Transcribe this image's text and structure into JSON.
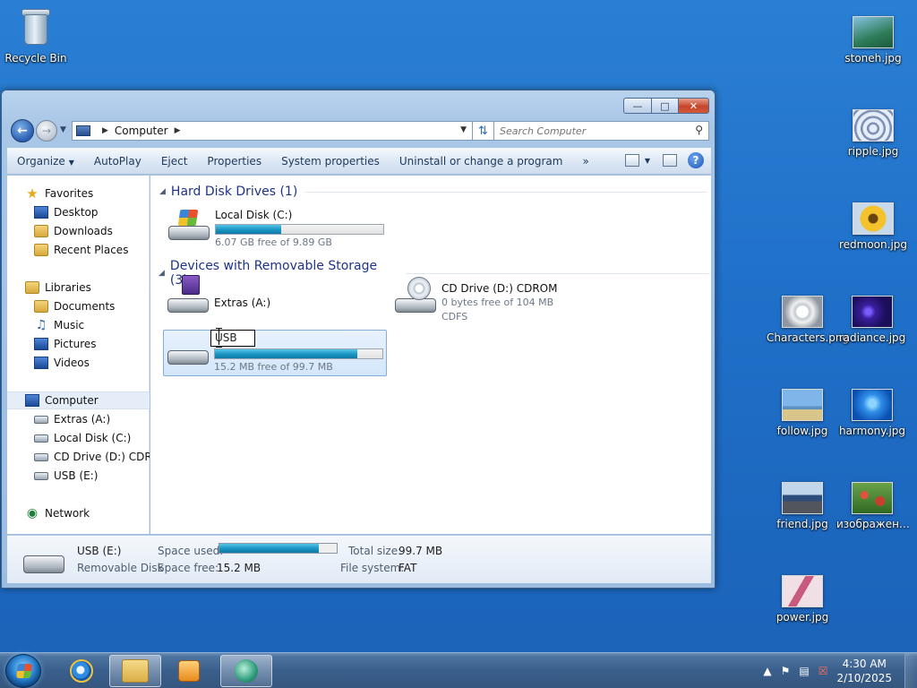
{
  "desktop": {
    "recycle_bin": "Recycle Bin",
    "files": [
      {
        "name": "stoneh.jpg",
        "colors": [
          "#2e7d5a",
          "#86c2e0"
        ]
      },
      {
        "name": "ripple.jpg",
        "colors": [
          "#d8e6f4",
          "#5a6f9a"
        ]
      },
      {
        "name": "redmoon.jpg",
        "colors": [
          "#f4c22c",
          "#e8a313"
        ]
      },
      {
        "name": "Characters.png",
        "colors": [
          "#e9e9e9",
          "#9aa3ad"
        ]
      },
      {
        "name": "radiance.jpg",
        "colors": [
          "#3a1d9a",
          "#1b0f5a"
        ]
      },
      {
        "name": "follow.jpg",
        "colors": [
          "#7fb6ea",
          "#d9c48a"
        ]
      },
      {
        "name": "harmony.jpg",
        "colors": [
          "#2f8ee8",
          "#0b4fb0"
        ]
      },
      {
        "name": "friend.jpg",
        "colors": [
          "#2d4e7a",
          "#c2d6ea"
        ]
      },
      {
        "name": "изображен…",
        "colors": [
          "#c7402e",
          "#3b7a2a"
        ]
      },
      {
        "name": "power.jpg",
        "colors": [
          "#f1dfe6",
          "#c9597d"
        ]
      }
    ]
  },
  "window": {
    "address": {
      "crumb": "Computer"
    },
    "search_placeholder": "Search Computer",
    "toolbar": {
      "organize": "Organize",
      "autoplay": "AutoPlay",
      "eject": "Eject",
      "properties": "Properties",
      "system_properties": "System properties",
      "uninstall": "Uninstall or change a program",
      "more": "»"
    },
    "nav": {
      "favorites": "Favorites",
      "desktop": "Desktop",
      "downloads": "Downloads",
      "recent": "Recent Places",
      "libraries": "Libraries",
      "documents": "Documents",
      "music": "Music",
      "pictures": "Pictures",
      "videos": "Videos",
      "computer": "Computer",
      "extras": "Extras (A:)",
      "local_disk": "Local Disk (C:)",
      "cd_drive": "CD Drive (D:) CDROM",
      "usb": "USB (E:)",
      "network": "Network"
    },
    "groups": {
      "hdd": "Hard Disk Drives (1)",
      "removable": "Devices with Removable Storage (3)"
    },
    "drives": {
      "c": {
        "name": "Local Disk (C:)",
        "free": "6.07 GB free of 9.89 GB",
        "used_fraction": 0.39
      },
      "a": {
        "name": "Extras (A:)"
      },
      "d": {
        "name": "CD Drive (D:) CDROM",
        "free": "0 bytes free of 104 MB",
        "fs": "CDFS"
      },
      "e": {
        "rename_value": "USB",
        "free": "15.2 MB free of 99.7 MB",
        "used_fraction": 0.85
      }
    },
    "details": {
      "name": "USB (E:)",
      "type": "Removable Disk",
      "space_used_label": "Space used:",
      "space_free_label": "Space free:",
      "space_free": "15.2 MB",
      "total_size_label": "Total size:",
      "total_size": "99.7 MB",
      "fs_label": "File system:",
      "fs": "FAT",
      "used_fraction": 0.85
    }
  },
  "taskbar": {
    "time": "4:30 AM",
    "date": "2/10/2025"
  }
}
